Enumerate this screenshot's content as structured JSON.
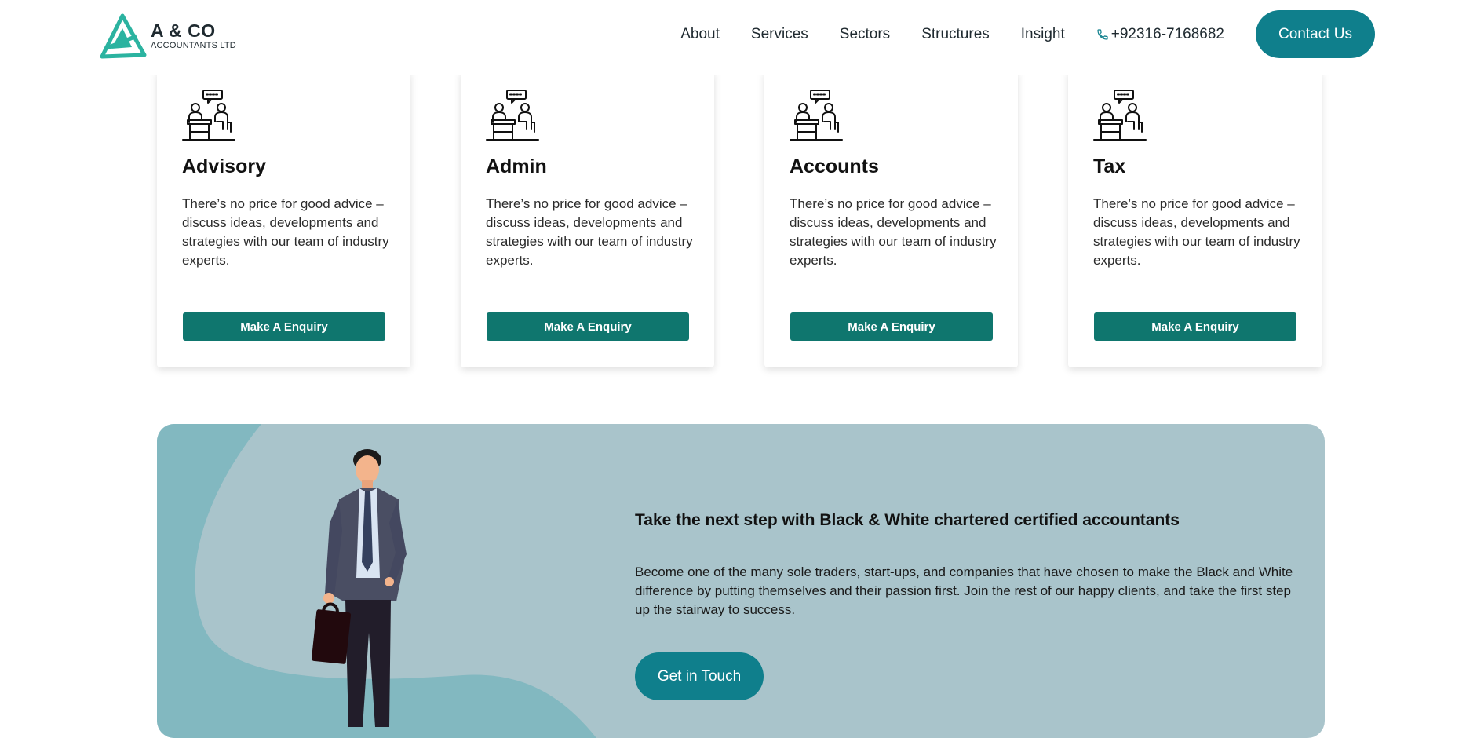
{
  "header": {
    "logo": {
      "name": "A & CO",
      "subtitle": "ACCOUNTANTS LTD",
      "icon": "logo-triangle-icon"
    },
    "nav": [
      "About",
      "Services",
      "Sectors",
      "Structures",
      "Insight"
    ],
    "phone": {
      "icon": "phone-icon",
      "number": "+92316-7168682"
    },
    "contact_label": "Contact Us"
  },
  "services": [
    {
      "title": "Advisory",
      "text": "There’s no price for good advice – discuss ideas, developments and strategies with our team of industry experts.",
      "button": "Make A Enquiry",
      "icon": "meeting-desk-icon"
    },
    {
      "title": "Admin",
      "text": "There’s no price for good advice – discuss ideas, developments and strategies with our team of industry experts.",
      "button": "Make A Enquiry",
      "icon": "meeting-desk-icon"
    },
    {
      "title": "Accounts",
      "text": "There’s no price for good advice – discuss ideas, developments and strategies with our team of industry experts.",
      "button": "Make A Enquiry",
      "icon": "meeting-desk-icon"
    },
    {
      "title": "Tax",
      "text": "There’s no price for good advice – discuss ideas, developments and strategies with our team of industry experts.",
      "button": "Make A Enquiry",
      "icon": "meeting-desk-icon"
    }
  ],
  "cta": {
    "title": "Take the next step with Black & White chartered certified accountants",
    "text": "Become one of the many sole traders, start-ups, and companies that have chosen to make the Black and White difference by putting themselves and their passion first. Join the rest of our happy clients, and take the first step up the stairway to success.",
    "button": "Get in Touch",
    "illustration": "businessman-illustration"
  },
  "colors": {
    "accent": "#0f7f8c",
    "button_dark": "#0f766e",
    "banner_bg": "#a9c4cb",
    "banner_shape": "#82b8c0",
    "logo_green": "#2bb3a0"
  }
}
